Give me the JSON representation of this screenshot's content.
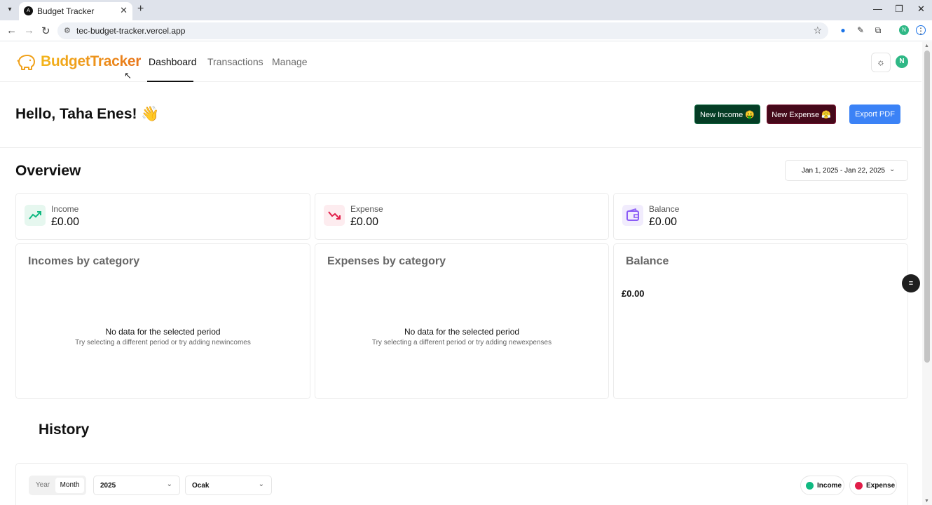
{
  "browser": {
    "tab_title": "Budget Tracker",
    "tab_favicon": "A",
    "url": "tec-budget-tracker.vercel.app",
    "icons": {
      "menu": "▾",
      "close": "✕",
      "new_tab": "+",
      "minimize": "—",
      "restore": "❐",
      "window_close": "✕",
      "back": "←",
      "forward": "→",
      "reload": "↻",
      "site_info": "⚙",
      "bookmark": "☆",
      "extension_1": "●",
      "extension_2": "✎",
      "extension_3": "⧉",
      "kebab": "⋮"
    }
  },
  "app": {
    "logo_text": "BudgetTracker",
    "nav": [
      "Dashboard",
      "Transactions",
      "Manage"
    ],
    "active_nav": "Dashboard",
    "theme_icon": "☼",
    "avatar_initial": "N",
    "colors": {
      "logo_start": "#f3b51a",
      "logo_end": "#e8761c",
      "income": "#10b981",
      "expense": "#e11d48",
      "balance": "#8b5cf6",
      "export": "#3b82f6"
    }
  },
  "greeting": {
    "text": "Hello, Taha Enes! 👋",
    "buttons": {
      "new_income": "New Income 🤑",
      "new_expense": "New Expense 😤",
      "export": "Export PDF"
    }
  },
  "overview": {
    "title": "Overview",
    "date_range": "Jan 1, 2025 - Jan 22, 2025",
    "chevron": "⌄",
    "stats": [
      {
        "label": "Income",
        "value": "£0.00",
        "icon": "trending-up-icon"
      },
      {
        "label": "Expense",
        "value": "£0.00",
        "icon": "trending-down-icon"
      },
      {
        "label": "Balance",
        "value": "£0.00",
        "icon": "wallet-icon"
      }
    ],
    "panels": {
      "incomes": {
        "title": "Incomes by category",
        "empty": "No data for the selected period",
        "hint": "Try selecting a different period or try adding newincomes"
      },
      "expenses": {
        "title": "Expenses by category",
        "empty": "No data for the selected period",
        "hint": "Try selecting a different period or try adding newexpenses"
      },
      "balance": {
        "title": "Balance",
        "value": "£0.00"
      }
    },
    "fab_icon": "≡"
  },
  "history": {
    "title": "History",
    "segments": [
      "Year",
      "Month"
    ],
    "active_segment": "Month",
    "year": "2025",
    "month": "Ocak",
    "chevron": "⌄",
    "legend": [
      {
        "label": "Income",
        "color": "#10b981"
      },
      {
        "label": "Expense",
        "color": "#e11d48"
      }
    ]
  }
}
